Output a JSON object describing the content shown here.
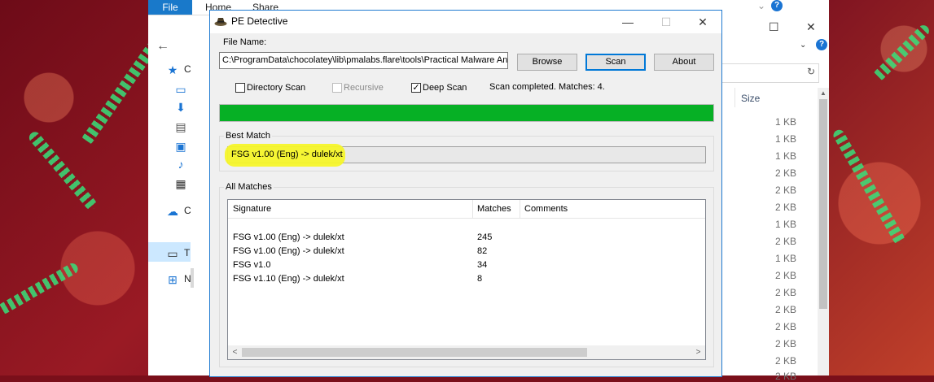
{
  "explorer": {
    "tabs": [
      "File",
      "Home",
      "Share"
    ],
    "nav_items": [
      "C",
      "",
      "",
      "",
      "",
      "",
      "",
      "C",
      "T",
      "N"
    ],
    "size_header": "Size",
    "sizes": [
      "1 KB",
      "1 KB",
      "1 KB",
      "2 KB",
      "2 KB",
      "2 KB",
      "1 KB",
      "2 KB",
      "1 KB",
      "2 KB",
      "2 KB",
      "2 KB",
      "2 KB",
      "2 KB",
      "2 KB",
      "2 KB"
    ]
  },
  "pe": {
    "title": "PE Detective",
    "file_name_label": "File Name:",
    "file_path": "C:\\ProgramData\\chocolatey\\lib\\pmalabs.flare\\tools\\Practical Malware An",
    "buttons": {
      "browse": "Browse",
      "scan": "Scan",
      "about": "About"
    },
    "options": {
      "directory_scan": {
        "label": "Directory Scan",
        "checked": false
      },
      "recursive": {
        "label": "Recursive",
        "checked": false,
        "disabled": true
      },
      "deep_scan": {
        "label": "Deep Scan",
        "checked": true
      }
    },
    "status": "Scan completed. Matches: 4.",
    "progress_fraction": 1.0,
    "best_match_label": "Best Match",
    "best_match": "FSG v1.00 (Eng) -> dulek/xt",
    "all_matches_label": "All Matches",
    "columns": [
      "Signature",
      "Matches",
      "Comments"
    ],
    "rows": [
      {
        "signature": "FSG v1.00 (Eng) -> dulek/xt",
        "matches": "245",
        "comments": ""
      },
      {
        "signature": "FSG v1.00 (Eng) -> dulek/xt",
        "matches": "82",
        "comments": ""
      },
      {
        "signature": "FSG v1.0",
        "matches": "34",
        "comments": ""
      },
      {
        "signature": "FSG v1.10 (Eng) -> dulek/xt",
        "matches": "8",
        "comments": ""
      }
    ]
  },
  "colors": {
    "progress": "#06b025",
    "highlight": "#f5f52a",
    "accent": "#0078d7"
  }
}
